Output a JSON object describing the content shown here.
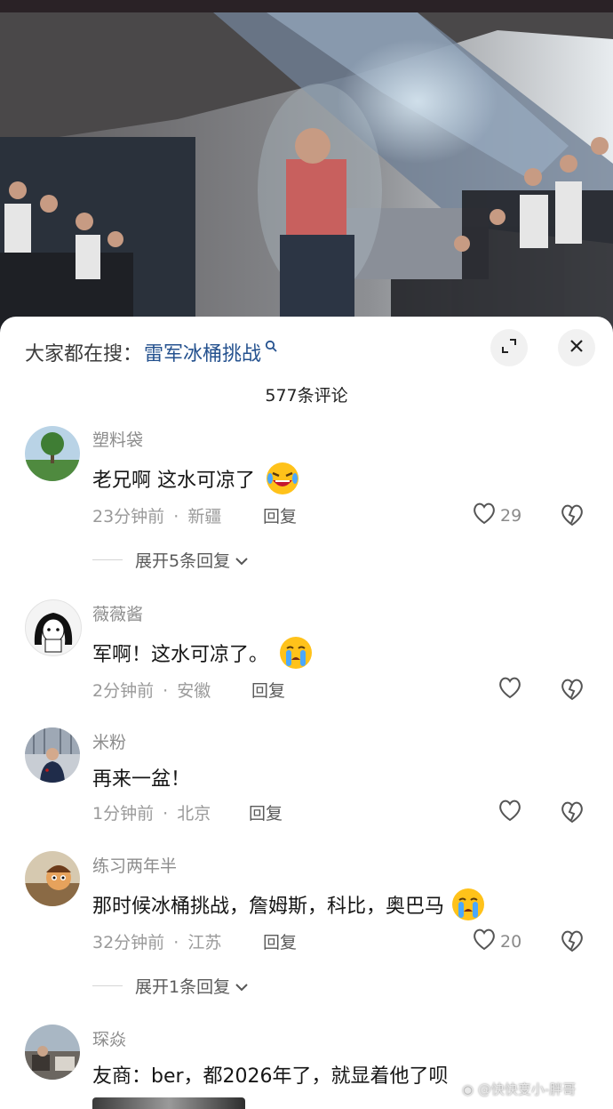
{
  "search": {
    "prefix": "大家都在搜：",
    "term": "雷军冰桶挑战"
  },
  "comment_count": "577条评论",
  "comments": [
    {
      "user": "塑料袋",
      "text": "老兄啊 这水可凉了",
      "emoji": "laughing-crying-emoji",
      "time": "23分钟前",
      "sep": "·",
      "location": "新疆",
      "reply": "回复",
      "likes": "29",
      "expand": "展开5条回复"
    },
    {
      "user": "薇薇酱",
      "text": "军啊！这水可凉了。",
      "emoji": "crying-emoji",
      "time": "2分钟前",
      "sep": "·",
      "location": "安徽",
      "reply": "回复",
      "likes": ""
    },
    {
      "user": "米粉",
      "text": "再来一盆！",
      "time": "1分钟前",
      "sep": "·",
      "location": "北京",
      "reply": "回复",
      "likes": ""
    },
    {
      "user": "练习两年半",
      "text": "那时候冰桶挑战，詹姆斯，科比，奥巴马",
      "emoji": "crying-emoji",
      "time": "32分钟前",
      "sep": "·",
      "location": "江苏",
      "reply": "回复",
      "likes": "20",
      "expand": "展开1条回复"
    },
    {
      "user": "琛焱",
      "text": "友商：ber，都2026年了，就显着他了呗"
    }
  ],
  "watermark": "@快快变小-胖哥",
  "colors": {
    "search_term": "#25528f",
    "text": "#161616",
    "muted": "#9a9a9a"
  }
}
